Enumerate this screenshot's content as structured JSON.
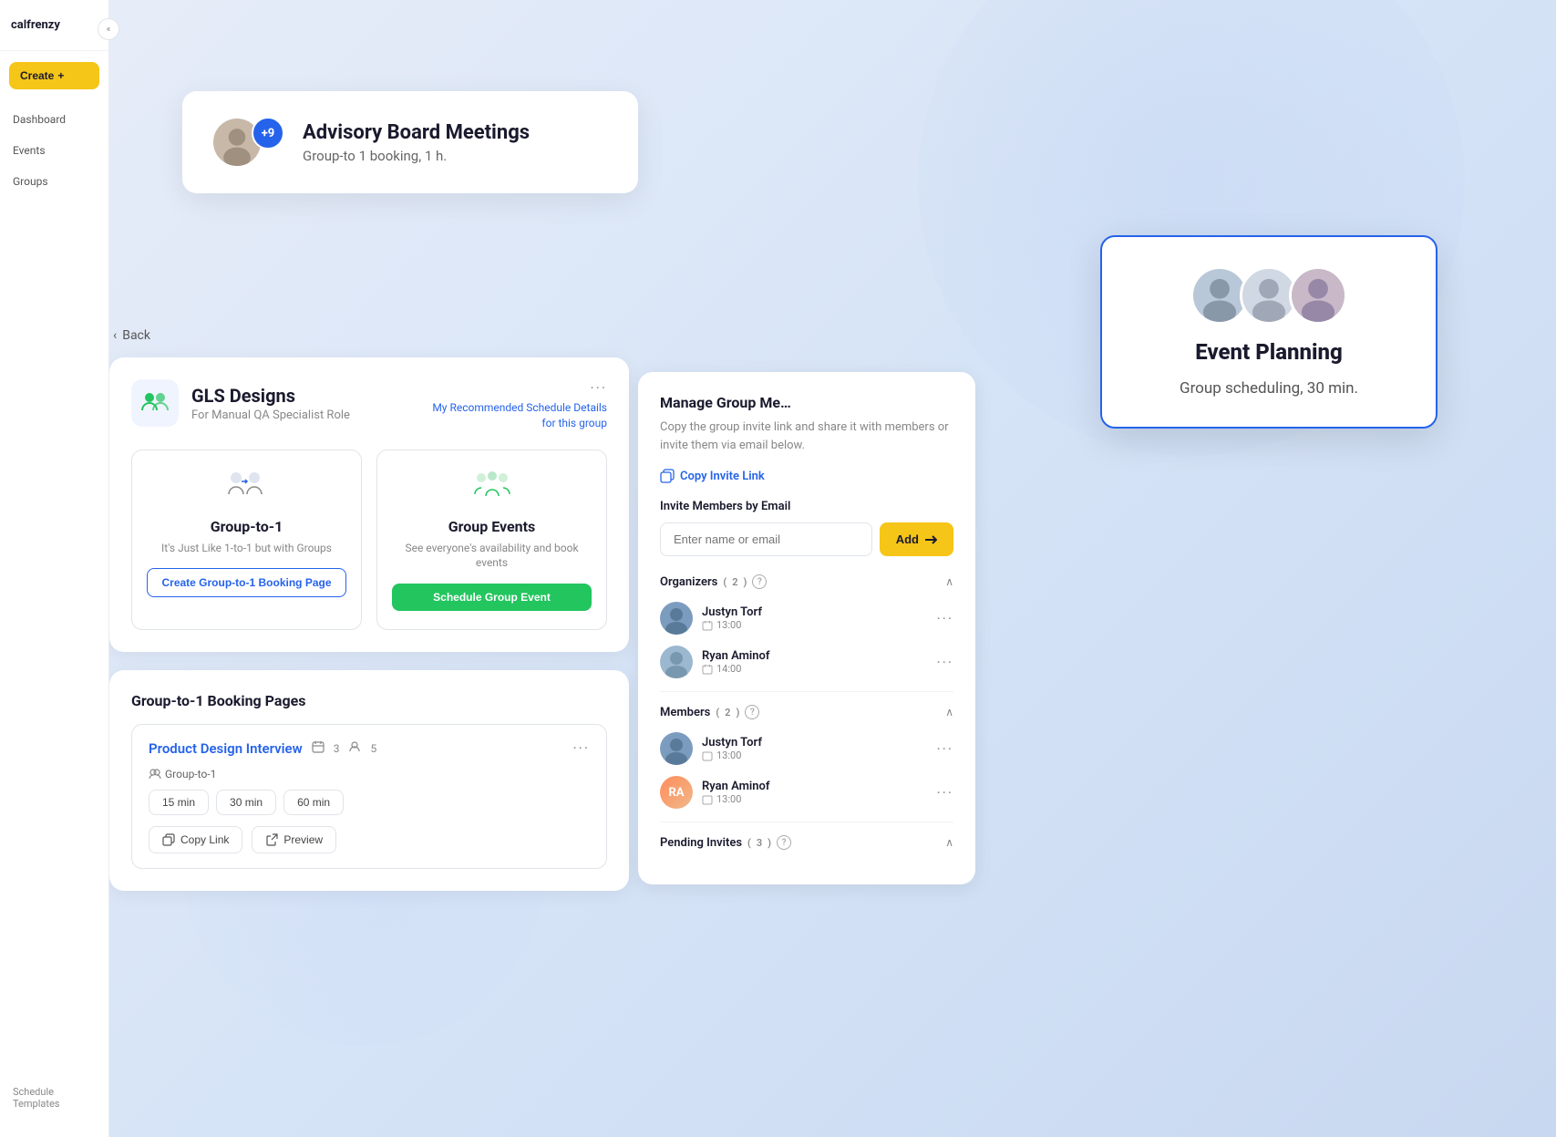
{
  "brand": "calfrenzy",
  "sidebar": {
    "collapse_icon": "«",
    "create_label": "Create",
    "nav_items": [
      {
        "id": "dashboard",
        "label": "Dashboard"
      },
      {
        "id": "events",
        "label": "Events"
      },
      {
        "id": "groups",
        "label": "Groups"
      }
    ],
    "footer_label": "Schedule Templates"
  },
  "advisory_card": {
    "title": "Advisory Board Meetings",
    "subtitle": "Group-to 1 booking, 1 h.",
    "avatar_count": "+9"
  },
  "event_planning_card": {
    "title": "Event Planning",
    "subtitle": "Group scheduling, 30 min."
  },
  "back_button": "Back",
  "group_section": {
    "icon_alt": "group-icon",
    "name": "GLS Designs",
    "subtitle": "For Manual QA Specialist Role",
    "recommended_link_line1": "My Recommended Schedule Details",
    "recommended_link_line2": "for this group"
  },
  "type_options": [
    {
      "id": "group-to-1",
      "title": "Group-to-1",
      "description": "It's Just Like 1-to-1 but with Groups",
      "button_label": "Create Group-to-1 Booking Page",
      "button_type": "outline"
    },
    {
      "id": "group-events",
      "title": "Group Events",
      "description": "See everyone's availability and book events",
      "button_label": "Schedule Group Event",
      "button_type": "solid-green"
    }
  ],
  "booking_pages_section": {
    "title": "Group-to-1 Booking Pages",
    "item": {
      "name": "Product Design Interview",
      "calendar_count": "3",
      "person_count": "5",
      "type_label": "Group-to-1",
      "durations": [
        "15 min",
        "30 min",
        "60 min"
      ],
      "actions": [
        {
          "id": "copy-link",
          "label": "Copy Link"
        },
        {
          "id": "preview",
          "label": "Preview"
        }
      ]
    }
  },
  "manage_panel": {
    "title": "Manage Group Me…",
    "description": "Copy the group invite link and share it with members or invite them via email below.",
    "copy_invite_label": "Copy Invite Link",
    "invite_email_label": "Invite Members by Email",
    "invite_placeholder": "Enter name or email",
    "add_button_label": "Add",
    "sections": [
      {
        "id": "organizers",
        "label": "Organizers",
        "count": "2",
        "members": [
          {
            "name": "Justyn Torf",
            "time": "13:00",
            "avatar_color": "#7c9cbf"
          },
          {
            "name": "Ryan Aminof",
            "time": "14:00",
            "avatar_color": "#9cb8d0"
          }
        ]
      },
      {
        "id": "members",
        "label": "Members",
        "count": "2",
        "members": [
          {
            "name": "Justyn Torf",
            "time": "13:00",
            "avatar_color": "#7c9cbf"
          },
          {
            "name": "Ryan Aminof",
            "time": "13:00",
            "initials": "RA",
            "avatar_color": "#ff6b35"
          }
        ]
      },
      {
        "id": "pending-invites",
        "label": "Pending Invites",
        "count": "3"
      }
    ]
  }
}
